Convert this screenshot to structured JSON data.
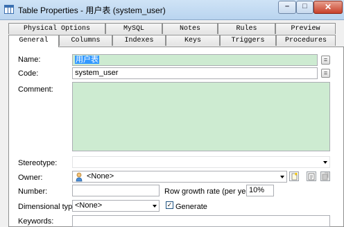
{
  "window": {
    "title": "Table Properties - 用户表 (system_user)",
    "minimize_glyph": "–",
    "maximize_glyph": "□",
    "close_glyph": "✕"
  },
  "tabs_row1": [
    "Physical Options",
    "MySQL",
    "Notes",
    "Rules",
    "Preview"
  ],
  "tabs_row2": [
    "General",
    "Columns",
    "Indexes",
    "Keys",
    "Triggers",
    "Procedures"
  ],
  "active_tab": "General",
  "form": {
    "name_label": "Name:",
    "name_value": "用户表",
    "name_button": "=",
    "code_label": "Code:",
    "code_value": "system_user",
    "code_button": "=",
    "comment_label": "Comment:",
    "comment_value": "",
    "stereotype_label": "Stereotype:",
    "stereotype_value": "",
    "owner_label": "Owner:",
    "owner_value": "<None>",
    "number_label": "Number:",
    "number_value": "",
    "row_growth_label": "Row growth rate (per year):",
    "row_growth_value": "10%",
    "dimensional_label": "Dimensional type:",
    "dimensional_value": "<None>",
    "generate_label": "Generate",
    "generate_checked": true,
    "generate_mark": "✓",
    "keywords_label": "Keywords:"
  },
  "icons": {
    "app": "table-properties-icon",
    "owner": "user-icon",
    "owner_tools": [
      "new-icon",
      "properties-icon",
      "delete-icon"
    ]
  },
  "colors": {
    "name_field_bg": "#cdebd1",
    "selection": "#3399ff",
    "close_button": "#c7402a"
  }
}
